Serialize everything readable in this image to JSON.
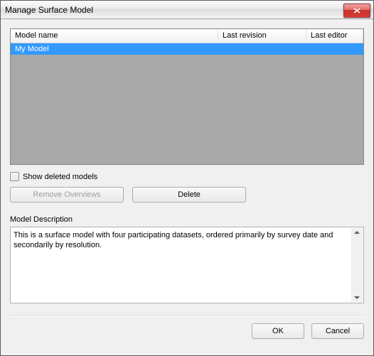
{
  "window": {
    "title": "Manage Surface Model"
  },
  "listview": {
    "columns": {
      "name": "Model name",
      "revision": "Last revision",
      "editor": "Last editor"
    },
    "rows": [
      {
        "name": "My Model",
        "revision": "",
        "editor": ""
      }
    ]
  },
  "checkbox": {
    "show_deleted_label": "Show deleted models"
  },
  "buttons": {
    "remove_overviews": "Remove Overviews",
    "delete": "Delete",
    "ok": "OK",
    "cancel": "Cancel"
  },
  "description": {
    "label": "Model Description",
    "text": "This is a surface model with four participating datasets, ordered primarily by survey date and secondarily by resolution."
  }
}
